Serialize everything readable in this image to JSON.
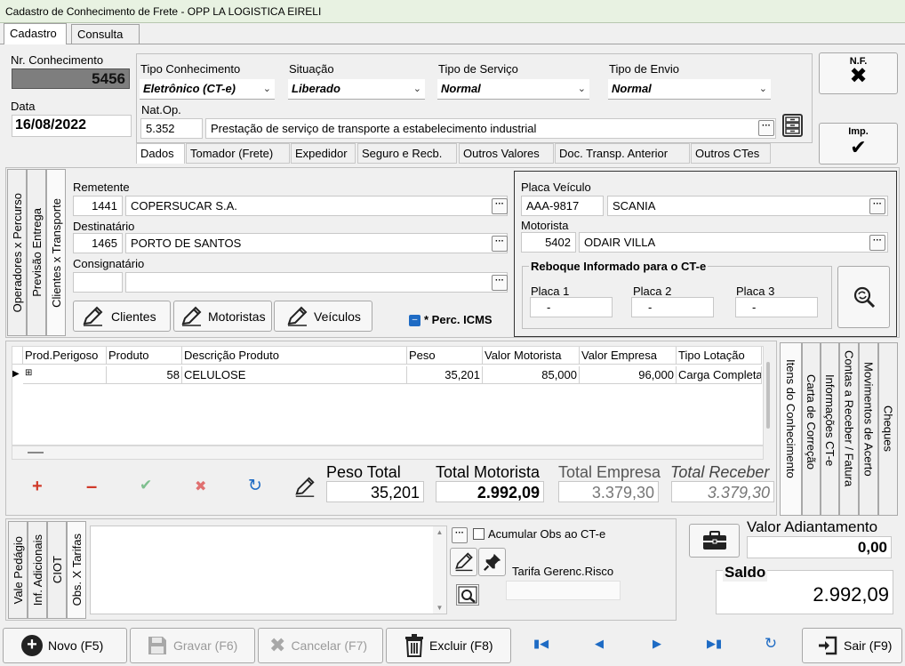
{
  "window": {
    "title": "Cadastro de Conhecimento de Frete - OPP LA LOGISTICA EIRELI"
  },
  "top_tabs": [
    "Cadastro",
    "Consulta"
  ],
  "header": {
    "nr_label": "Nr. Conhecimento",
    "nr_value": "5456",
    "data_label": "Data",
    "data_value": "16/08/2022",
    "tipo_conhecimento_label": "Tipo Conhecimento",
    "tipo_conhecimento_value": "Eletrônico (CT-e)",
    "situacao_label": "Situação",
    "situacao_value": "Liberado",
    "tipo_servico_label": "Tipo de Serviço",
    "tipo_servico_value": "Normal",
    "tipo_envio_label": "Tipo de Envio",
    "tipo_envio_value": "Normal",
    "natop_label": "Nat.Op.",
    "natop_code": "5.352",
    "natop_desc": "Prestação de serviço de transporte a estabelecimento industrial",
    "nf_label": "N.F.",
    "imp_label": "Imp."
  },
  "detail_tabs": [
    "Dados",
    "Tomador (Frete)",
    "Expedidor",
    "Seguro e Recb.",
    "Outros Valores",
    "Doc. Transp. Anterior",
    "Outros CTes"
  ],
  "left_vtabs": [
    "Operadores x Percurso",
    "Previsão Entrega",
    "Clientes x Transporte"
  ],
  "parties": {
    "remetente_label": "Remetente",
    "remetente_code": "1441",
    "remetente_name": "COPERSUCAR S.A.",
    "destinatario_label": "Destinatário",
    "destinatario_code": "1465",
    "destinatario_name": "PORTO DE SANTOS",
    "consignatario_label": "Consignatário",
    "consignatario_code": "",
    "consignatario_name": ""
  },
  "action_buttons": {
    "clientes": "Clientes",
    "motoristas": "Motoristas",
    "veiculos": "Veículos"
  },
  "perc_icms_label": "* Perc. ICMS",
  "vehicle": {
    "placa_label": "Placa Veículo",
    "placa_value": "AAA-9817",
    "modelo_value": "SCANIA",
    "motorista_label": "Motorista",
    "motorista_code": "5402",
    "motorista_name": "ODAIR VILLA",
    "reboque_title": "Reboque Informado para o CT-e",
    "placa1_label": "Placa 1",
    "placa1_value": "-",
    "placa2_label": "Placa 2",
    "placa2_value": "-",
    "placa3_label": "Placa 3",
    "placa3_value": "-"
  },
  "grid": {
    "columns": [
      "Prod.Perigoso",
      "Produto",
      "Descrição Produto",
      "Peso",
      "Valor Motorista",
      "Valor Empresa",
      "Tipo Lotação"
    ],
    "rows": [
      {
        "perigoso": "⊞",
        "produto": "58",
        "descricao": "CELULOSE",
        "peso": "35,201",
        "valor_motorista": "85,000",
        "valor_empresa": "96,000",
        "tipo_lotacao": "Carga Completa"
      }
    ]
  },
  "totals": {
    "peso_label": "Peso Total",
    "peso_value": "35,201",
    "motorista_label": "Total Motorista",
    "motorista_value": "2.992,09",
    "empresa_label": "Total Empresa",
    "empresa_value": "3.379,30",
    "receber_label": "Total Receber",
    "receber_value": "3.379,30"
  },
  "right_vtabs": [
    "Itens do Conhecimento",
    "Carta de Correção",
    "Informações CT-e",
    "Contas a Receber / Fatura",
    "Movimentos de Acerto",
    "Cheques"
  ],
  "bottom_vtabs": [
    "Vale Pedágio",
    "Inf. Adicionais",
    "CIOT",
    "Obs. X Tarifas"
  ],
  "obs": {
    "acumular_label": "Acumular Obs ao CT-e",
    "tarifa_label": "Tarifa Gerenc.Risco"
  },
  "adiantamento": {
    "label": "Valor Adiantamento",
    "value": "0,00",
    "saldo_label": "Saldo",
    "saldo_value": "2.992,09"
  },
  "footer": {
    "novo": "Novo (F5)",
    "gravar": "Gravar (F6)",
    "cancelar": "Cancelar (F7)",
    "excluir": "Excluir (F8)",
    "sair": "Sair (F9)"
  },
  "colors": {
    "accent_blue": "#1e6bc4",
    "add_red": "#d03a2a",
    "confirm_green": "#7fbf8f",
    "nr_field_bg": "#808080",
    "title_bg": "#e8f2e2"
  }
}
